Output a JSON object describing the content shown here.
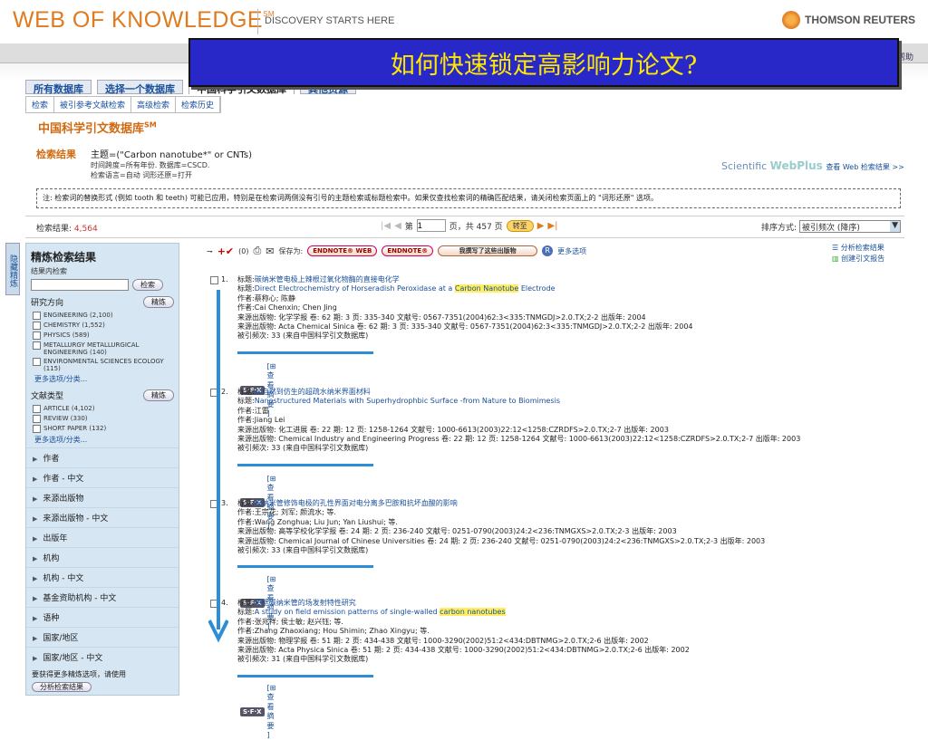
{
  "header": {
    "logo": "WEB OF KNOWLEDGE",
    "logo_sm": "SM",
    "tagline": "DISCOVERY STARTS HERE",
    "brand": "THOMSON REUTERS",
    "help": "帮助"
  },
  "banner": "如何快速锁定高影响力论文?",
  "tabs": [
    "所有数据库",
    "选择一个数据库",
    "中国科学引文数据库",
    "其他资源"
  ],
  "subnav": [
    "检索",
    "被引参考文献检索",
    "高级检索",
    "检索历史"
  ],
  "db_title": "中国科学引文数据库",
  "db_title_sm": "SM",
  "search": {
    "label": "检索结果",
    "query": "主题=(\"Carbon nanotube*\" or CNTs)",
    "line2": "时间跨度=所有年份. 数据库=CSCD.",
    "line3": "检索语言=自动  词形还原=打开"
  },
  "webplus": {
    "brand1": "Scientific ",
    "brand2": "WebPlus",
    "link": "查看 Web 检索结果 >>"
  },
  "note": "注: 检索词的替换形式 (例如 tooth 和 teeth) 可能已应用，特别是在检索词两侧没有引号的主题检索或标题检索中。如果仅查找检索词的精确匹配结果，请关闭检索页面上的 \"词形还原\" 选项。",
  "results": {
    "label": "检索结果:",
    "count": "4,564"
  },
  "pager": {
    "page_label": "第",
    "page": "1",
    "total": "页，共 457 页",
    "go": "转至"
  },
  "sort": {
    "label": "排序方式:",
    "value": "被引频次 (降序)"
  },
  "sidebar": {
    "title": "精炼检索结果",
    "sub": "结果内检索",
    "search_btn": "检索",
    "refine_btn": "精炼",
    "tab": "隐藏精炼",
    "sec1": "研究方向",
    "sec1_items": [
      "ENGINEERING (2,100)",
      "CHEMISTRY (1,552)",
      "PHYSICS (589)",
      "METALLURGY METALLURGICAL ENGINEERING (140)",
      "ENVIRONMENTAL SCIENCES ECOLOGY (115)"
    ],
    "more1": "更多选项/分类...",
    "sec2": "文献类型",
    "sec2_items": [
      "ARTICLE (4,102)",
      "REVIEW (330)",
      "SHORT PAPER (132)"
    ],
    "more2": "更多选项/分类...",
    "nodes": [
      "作者",
      "作者 - 中文",
      "来源出版物",
      "来源出版物 - 中文",
      "出版年",
      "机构",
      "机构 - 中文",
      "基金资助机构 - 中文",
      "语种",
      "国家/地区",
      "国家/地区 - 中文"
    ],
    "foot": "要获得更多精炼选项，请使用",
    "foot_btn": "分析检索结果"
  },
  "toolbar": {
    "count": "(0)",
    "save_label": "保存为:",
    "btn1": "ENDNOTE® WEB",
    "btn2": "ENDNOTE®",
    "btn3": "我撰写了这些出版物",
    "more": "更多选项"
  },
  "right_links": [
    "分析检索结果",
    "创建引文报告"
  ],
  "records": [
    {
      "n": "1.",
      "title_cn": "碳纳米管电极上辣根过氧化物酶的直接电化学",
      "title_en_pre": "Direct Electrochemistry of Horseradish Peroxidase at a ",
      "title_en_hl": "Carbon Nanotube",
      "title_en_post": " Electrode",
      "author_cn": "蔡称心; 陈静",
      "author_en": "Cai Chenxin; Chen Jing",
      "src_cn": "来源出版物: 化学学报  卷: 62  期: 3  页: 335-340  文献号: 0567-7351(2004)62:3<335:TNMGDJ>2.0.TX;2-2  出版年: 2004",
      "src_en": "来源出版物: Acta Chemical Sinica  卷: 62  期: 3  页: 335-340  文献号: 0567-7351(2004)62:3<335:TNMGDJ>2.0.TX;2-2  出版年: 2004",
      "cited": "被引频次: 33 (来自中国科学引文数据库)"
    },
    {
      "n": "2.",
      "title_cn": "从自然到仿生的超疏水纳米界面材料",
      "title_en_pre": "Nanostructured Materials with Superhydrophbic Surface -from Nature to Biomimesis",
      "title_en_hl": "",
      "title_en_post": "",
      "author_cn": "江雷",
      "author_en": "Jiang Lei",
      "src_cn": "来源出版物: 化工进展  卷: 22  期: 12  页: 1258-1264  文献号: 1000-6613(2003)22:12<1258:CZRDFS>2.0.TX;2-7  出版年: 2003",
      "src_en": "来源出版物: Chemical Industry and Engineering Progress  卷: 22  期: 12  页: 1258-1264  文献号: 1000-6613(2003)22:12<1258:CZRDFS>2.0.TX;2-7  出版年: 2003",
      "cited": "被引频次: 33 (来自中国科学引文数据库)"
    },
    {
      "n": "3.",
      "title_cn": "碳纳米管修饰电极的孔性界面对电分离多巴胺和抗坏血酸的影响",
      "title_en_pre": "",
      "title_en_hl": "",
      "title_en_post": "",
      "author_cn": "王宗花; 刘军; 颜流水; 等.",
      "author_en": "Wang Zonghua; Liu Jun; Yan Liushui; 等.",
      "src_cn": "来源出版物: 高等学校化学学报  卷: 24  期: 2  页: 236-240  文献号: 0251-0790(2003)24:2<236:TNMGXS>2.0.TX;2-3  出版年: 2003",
      "src_en": "来源出版物: Chemical Journal of Chinese Universities  卷: 24  期: 2  页: 236-240  文献号: 0251-0790(2003)24:2<236:TNMGXS>2.0.TX;2-3  出版年: 2003",
      "cited": "被引频次: 33 (来自中国科学引文数据库)"
    },
    {
      "n": "4.",
      "title_cn": "单壁碳纳米管的场发射特性研究",
      "title_en_pre": "A study on field emission patterns of single-walled ",
      "title_en_hl": "carbon nanotubes",
      "title_en_post": "",
      "author_cn": "张兆祥; 侯士敏; 赵兴钰; 等.",
      "author_en": "Zhang Zhaoxiang; Hou Shimin; Zhao Xingyu; 等.",
      "src_cn": "来源出版物: 物理学报  卷: 51  期: 2  页: 434-438  文献号: 1000-3290(2002)51:2<434:DBTNMG>2.0.TX;2-6  出版年: 2002",
      "src_en": "来源出版物: Acta Physica Sinica  卷: 51  期: 2  页: 434-438  文献号: 1000-3290(2002)51:2<434:DBTNMG>2.0.TX;2-6  出版年: 2002",
      "cited": "被引频次: 31 (来自中国科学引文数据库)"
    }
  ],
  "labels": {
    "title": "标题:",
    "author": "作者:",
    "sfx": "S·F·X",
    "abstract": "[⊞ 查看摘要 ]"
  }
}
